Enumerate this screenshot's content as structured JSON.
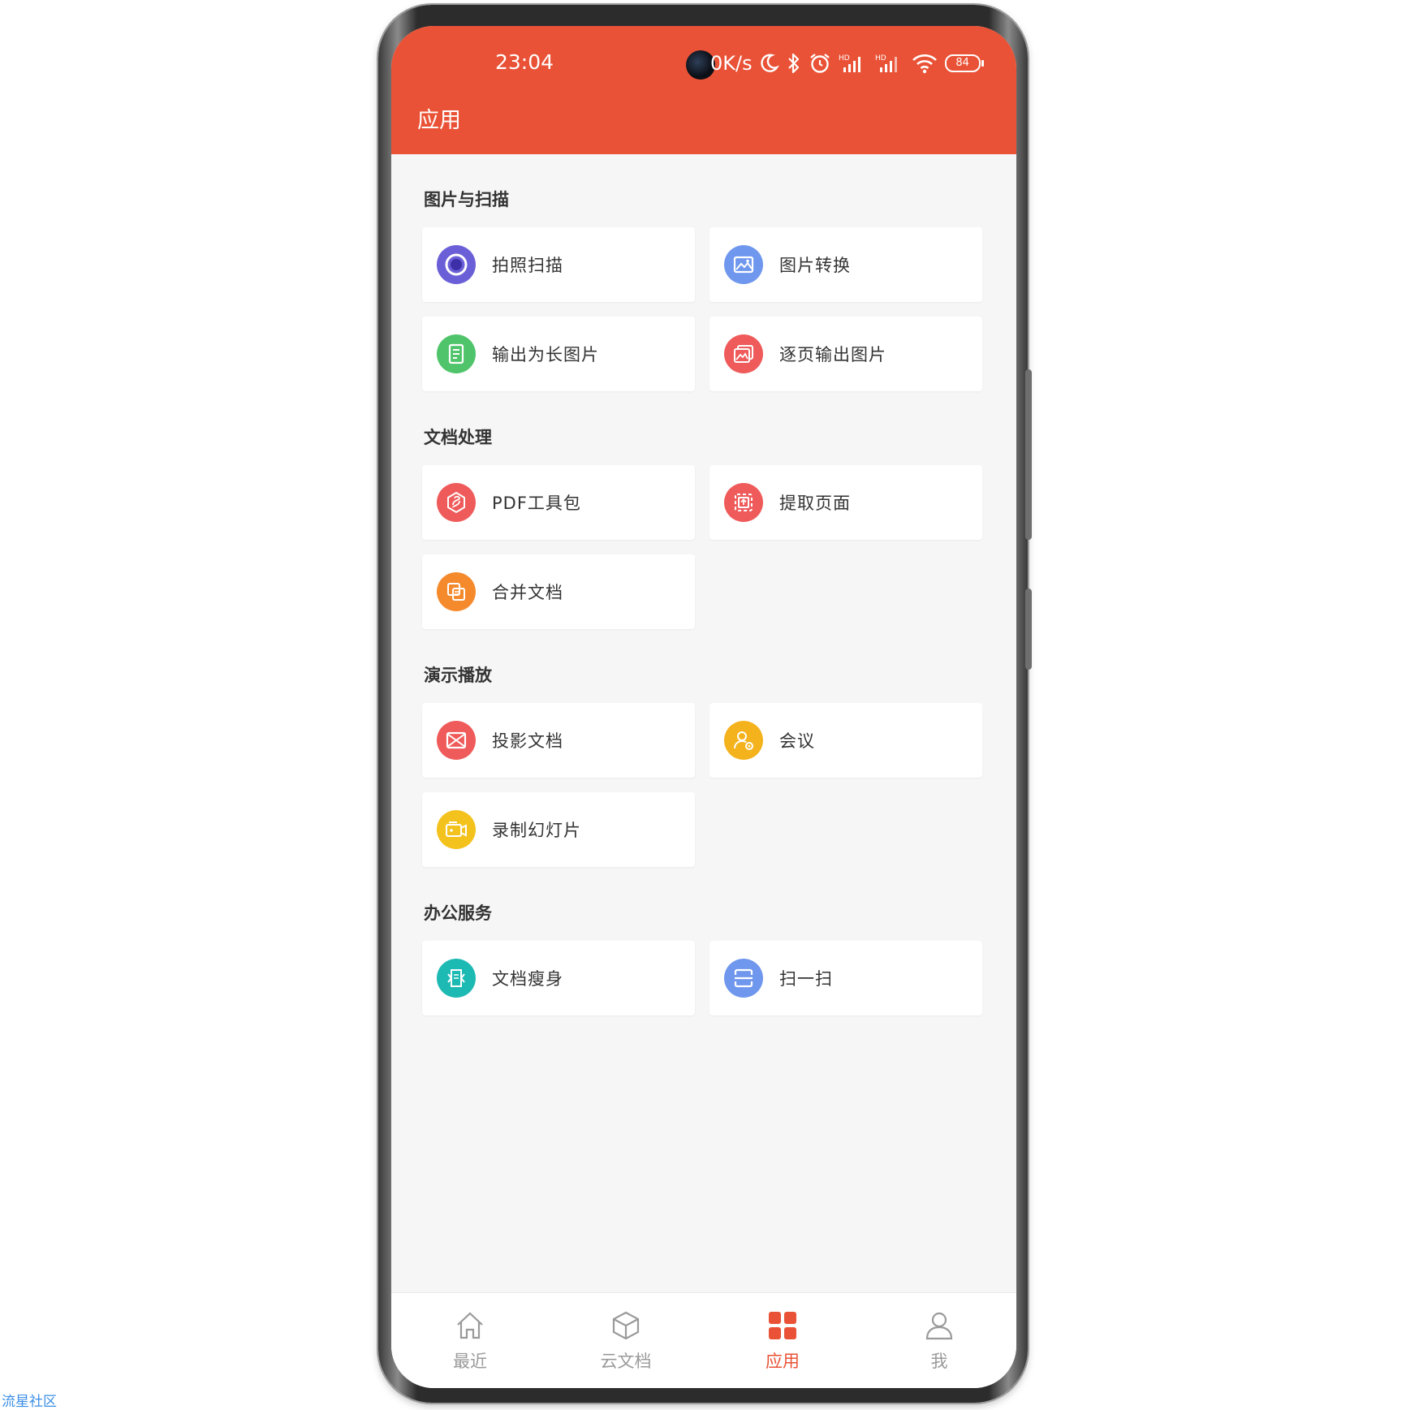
{
  "status_bar": {
    "time": "23:04",
    "net_speed": "0K/s",
    "battery": "84",
    "icons": [
      "moon-icon",
      "bluetooth-icon",
      "alarm-icon",
      "hd-signal-icon",
      "hd-signal-icon",
      "wifi-icon",
      "battery-icon"
    ]
  },
  "header": {
    "title": "应用"
  },
  "colors": {
    "header": "#e95236",
    "accent": "#e95236",
    "background": "#f6f6f6"
  },
  "sections": [
    {
      "title": "图片与扫描",
      "items": [
        {
          "label": "拍照扫描",
          "icon": "camera-scan-icon",
          "color": "#6b5fd8"
        },
        {
          "label": "图片转换",
          "icon": "image-convert-icon",
          "color": "#6f97ee"
        },
        {
          "label": "输出为长图片",
          "icon": "long-image-icon",
          "color": "#4fc46a"
        },
        {
          "label": "逐页输出图片",
          "icon": "page-image-icon",
          "color": "#ef5a5a"
        }
      ]
    },
    {
      "title": "文档处理",
      "items": [
        {
          "label": "PDF工具包",
          "icon": "pdf-toolkit-icon",
          "color": "#ef5a5a"
        },
        {
          "label": "提取页面",
          "icon": "extract-page-icon",
          "color": "#ef5a5a"
        },
        {
          "label": "合并文档",
          "icon": "merge-doc-icon",
          "color": "#f58a2c"
        }
      ]
    },
    {
      "title": "演示播放",
      "items": [
        {
          "label": "投影文档",
          "icon": "projection-icon",
          "color": "#ef5a5a"
        },
        {
          "label": "会议",
          "icon": "meeting-icon",
          "color": "#f4b21d"
        },
        {
          "label": "录制幻灯片",
          "icon": "record-slides-icon",
          "color": "#f4c21d"
        }
      ]
    },
    {
      "title": "办公服务",
      "items": [
        {
          "label": "文档瘦身",
          "icon": "doc-slim-icon",
          "color": "#1dbab3"
        },
        {
          "label": "扫一扫",
          "icon": "scan-code-icon",
          "color": "#6f97ee"
        }
      ]
    }
  ],
  "tabs": [
    {
      "label": "最近",
      "icon": "home-icon",
      "active": false
    },
    {
      "label": "云文档",
      "icon": "cube-icon",
      "active": false
    },
    {
      "label": "应用",
      "icon": "apps-grid-icon",
      "active": true
    },
    {
      "label": "我",
      "icon": "user-icon",
      "active": false
    }
  ],
  "watermark": "流星社区"
}
